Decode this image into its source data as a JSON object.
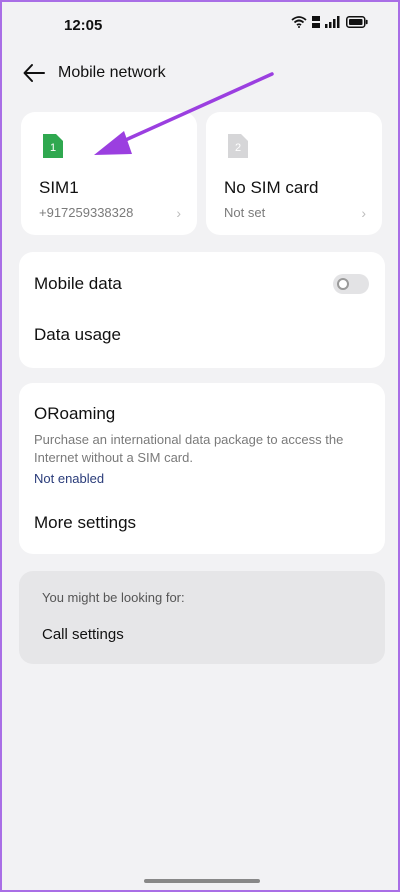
{
  "status": {
    "time": "12:05",
    "icons": [
      "wifi-icon",
      "volte-icon",
      "signal-icon",
      "battery-icon"
    ]
  },
  "header": {
    "title": "Mobile network"
  },
  "sims": [
    {
      "badge": "1",
      "name": "SIM1",
      "subtitle": "+917259338328",
      "badge_color": "#2fa84f"
    },
    {
      "badge": "2",
      "name": "No SIM card",
      "subtitle": "Not set",
      "badge_color": "#d6d6d8"
    }
  ],
  "data_card": {
    "mobile_data_label": "Mobile data",
    "mobile_data_enabled": false,
    "data_usage_label": "Data usage"
  },
  "roaming_card": {
    "title": "ORoaming",
    "description": "Purchase an international data package to access the Internet without a SIM card.",
    "status": "Not enabled",
    "more_settings_label": "More settings"
  },
  "suggestion_card": {
    "hint": "You might be looking for:",
    "call_settings_label": "Call settings"
  },
  "colors": {
    "accent_arrow": "#9b3fe0",
    "background": "#f2f2f4",
    "link_text": "#2a3c7a"
  }
}
